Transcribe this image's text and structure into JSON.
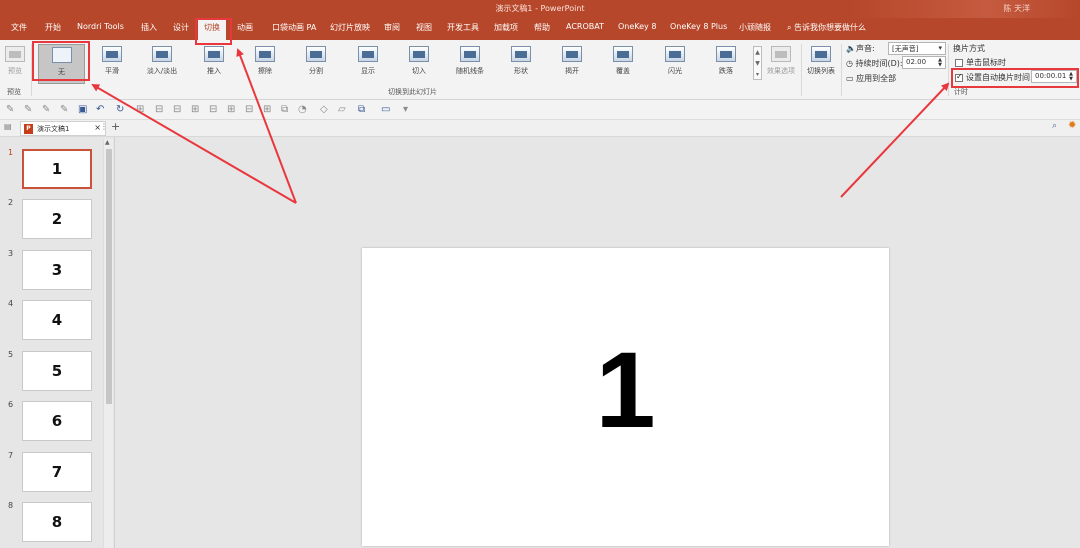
{
  "titlebar": {
    "title": "演示文稿1  -  PowerPoint",
    "user": "陈 天洋"
  },
  "tabs": [
    "文件",
    "开始",
    "Nordri Tools",
    "插入",
    "设计",
    "切换",
    "动画",
    "口袋动画 PA",
    "幻灯片放映",
    "审阅",
    "视图",
    "开发工具",
    "加载项",
    "帮助",
    "ACROBAT",
    "OneKey 8",
    "OneKey 8 Plus",
    "小顽随报"
  ],
  "active_tab": "切换",
  "tell_me": "告诉我你想要做什么",
  "ribbon": {
    "preview_label": "预览",
    "preview_group": "预览",
    "transitions": [
      "无",
      "平滑",
      "淡入/淡出",
      "推入",
      "擦除",
      "分割",
      "显示",
      "切入",
      "随机线条",
      "形状",
      "揭开",
      "覆盖",
      "闪光",
      "跌落"
    ],
    "selected_transition": "无",
    "effect_options": "效果选项",
    "transitions_group": "切换到此幻灯片",
    "transition_list": "切换列表",
    "sound_label": "声音:",
    "sound_value": "[无声音]",
    "duration_label": "持续时间(D):",
    "duration_value": "02.00",
    "apply_all": "应用到全部",
    "advance_title": "换片方式",
    "on_click": "单击鼠标时",
    "on_click_checked": false,
    "auto_after": "设置自动换片时间:",
    "auto_after_checked": true,
    "auto_after_value": "00:00.01",
    "timing_group": "计时"
  },
  "document_tab": "演示文稿1",
  "slides": [
    "1",
    "2",
    "3",
    "4",
    "5",
    "6",
    "7",
    "8"
  ],
  "slide_numbers": [
    "1",
    "2",
    "3",
    "4",
    "5",
    "6",
    "7",
    "8"
  ],
  "active_slide": "1",
  "canvas_text": "1",
  "colors": {
    "brand": "#b7472a",
    "annotation": "#e8383d",
    "active_thumb_border": "#c8533a"
  }
}
